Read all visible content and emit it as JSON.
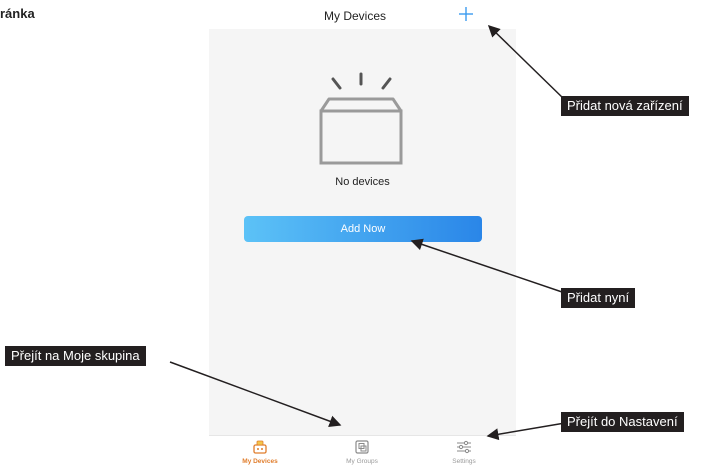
{
  "page_heading": "ránka",
  "header": {
    "title": "My Devices"
  },
  "main": {
    "empty_text": "No devices",
    "add_now_label": "Add Now"
  },
  "tabbar": {
    "tabs": [
      {
        "label": "My Devices",
        "icon": "router-icon",
        "active": true
      },
      {
        "label": "My Groups",
        "icon": "groups-icon",
        "active": false
      },
      {
        "label": "Settings",
        "icon": "sliders-icon",
        "active": false
      }
    ]
  },
  "callouts": {
    "add_new_devices": "Přidat nová zařízení",
    "add_now": "Přidat nyní",
    "go_to_groups": "Přejít na Moje skupina",
    "go_to_settings": "Přejít do Nastavení"
  },
  "colors": {
    "accent_blue": "#3a9bef",
    "active_tab": "#e07d2c",
    "screen_bg": "#f5f5f5",
    "callout_bg": "#231f20"
  }
}
